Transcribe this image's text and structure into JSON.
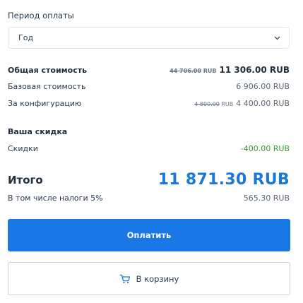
{
  "period": {
    "label": "Период оплаты",
    "selected": "Год"
  },
  "summary": {
    "total_cost_label": "Общая стоимость",
    "total_cost_old": "44 706.00",
    "total_cost_old_currency": "RUB",
    "total_cost": "11 306.00 RUB",
    "base_cost_label": "Базовая стоимость",
    "base_cost": "6 906.00 RUB",
    "config_label": "За конфигурацию",
    "config_old": "4 800.00",
    "config_old_currency": "RUB",
    "config_cost": "4 400.00 RUB"
  },
  "discount": {
    "title": "Ваша скидка",
    "label": "Скидки",
    "value": "-400.00 RUB"
  },
  "total": {
    "label": "Итого",
    "value": "11 871.30 RUB",
    "tax_label": "В том числе налоги 5%",
    "tax_value": "565.30 RUB"
  },
  "actions": {
    "pay_label": "Оплатить",
    "cart_label": "В корзину"
  },
  "colors": {
    "accent": "#1a78e6",
    "total_amount": "#1a78d6",
    "discount": "#3b9a3b"
  },
  "icons": {
    "select_chevron": "chevron-down-icon",
    "cart": "cart-icon"
  }
}
